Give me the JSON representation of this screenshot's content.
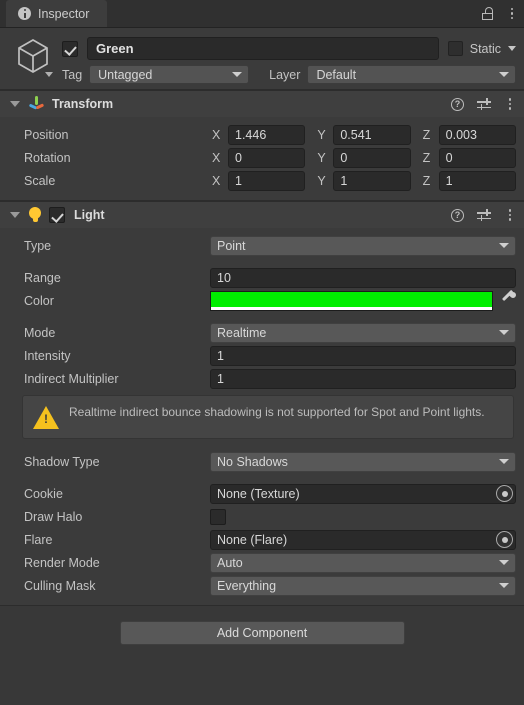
{
  "window": {
    "tab_label": "Inspector",
    "tab_icon": "info-icon",
    "lock_icon": "unlocked-padlock-icon",
    "menu_icon": "kebab-menu-icon"
  },
  "object_header": {
    "icon": "cube-icon",
    "enabled": true,
    "name": "Green",
    "static_label": "Static",
    "static_checked": false,
    "tag_label": "Tag",
    "tag_value": "Untagged",
    "layer_label": "Layer",
    "layer_value": "Default"
  },
  "components": [
    {
      "title": "Transform",
      "icon": "transform-gizmo-icon",
      "expanded": true,
      "rows": [
        {
          "label": "Position",
          "axes": [
            "X",
            "Y",
            "Z"
          ],
          "values": [
            "1.446",
            "0.541",
            "0.003"
          ]
        },
        {
          "label": "Rotation",
          "axes": [
            "X",
            "Y",
            "Z"
          ],
          "values": [
            "0",
            "0",
            "0"
          ]
        },
        {
          "label": "Scale",
          "axes": [
            "X",
            "Y",
            "Z"
          ],
          "values": [
            "1",
            "1",
            "1"
          ]
        }
      ]
    },
    {
      "title": "Light",
      "icon": "lightbulb-icon",
      "expanded": true,
      "enabled": true,
      "fields": {
        "type_label": "Type",
        "type_value": "Point",
        "range_label": "Range",
        "range_value": "10",
        "color_label": "Color",
        "color_value": "#00EE00",
        "mode_label": "Mode",
        "mode_value": "Realtime",
        "intensity_label": "Intensity",
        "intensity_value": "1",
        "indirect_label": "Indirect Multiplier",
        "indirect_value": "1",
        "warning_text": "Realtime indirect bounce shadowing is not supported for Spot and Point lights.",
        "shadow_label": "Shadow Type",
        "shadow_value": "No Shadows",
        "cookie_label": "Cookie",
        "cookie_value": "None (Texture)",
        "halo_label": "Draw Halo",
        "halo_checked": false,
        "flare_label": "Flare",
        "flare_value": "None (Flare)",
        "render_label": "Render Mode",
        "render_value": "Auto",
        "culling_label": "Culling Mask",
        "culling_value": "Everything"
      }
    }
  ],
  "footer": {
    "add_component_label": "Add Component"
  },
  "colors": {
    "panel_bg": "#383838",
    "component_bg": "#3b3b3b",
    "field_bg": "#2a2a2a",
    "popup_bg": "#585858",
    "warning_yellow": "#f5c11e",
    "light_color": "#00EE00"
  }
}
